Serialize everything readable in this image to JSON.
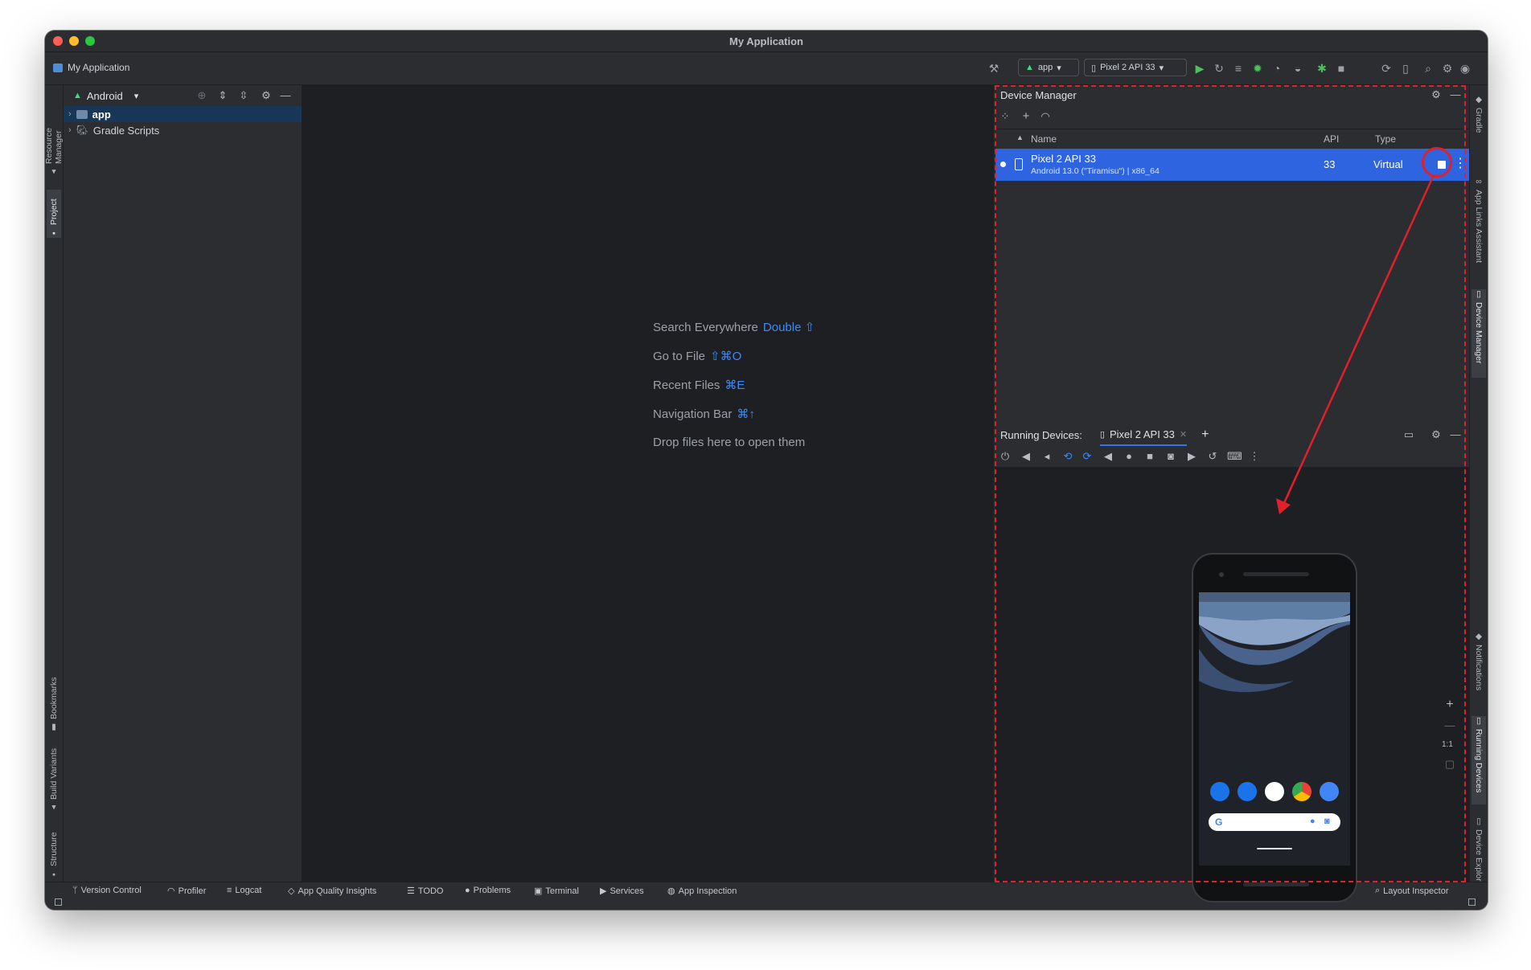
{
  "window": {
    "title": "My Application"
  },
  "toolbar": {
    "project": "My Application",
    "run_config": "app",
    "device": "Pixel 2 API 33"
  },
  "left_stripe": {
    "resource_manager": "Resource Manager",
    "project": "Project",
    "bookmarks": "Bookmarks",
    "build_variants": "Build Variants",
    "structure": "Structure"
  },
  "right_stripe": {
    "gradle": "Gradle",
    "app_links": "App Links Assistant",
    "device_manager": "Device Manager",
    "notifications": "Notifications",
    "running_devices": "Running Devices",
    "device_explorer": "Device Explorer"
  },
  "project_panel": {
    "view": "Android",
    "items": [
      {
        "label": "app"
      },
      {
        "label": "Gradle Scripts"
      }
    ]
  },
  "editor_hints": [
    {
      "label": "Search Everywhere",
      "key": "Double ⇧"
    },
    {
      "label": "Go to File",
      "key": "⇧⌘O"
    },
    {
      "label": "Recent Files",
      "key": "⌘E"
    },
    {
      "label": "Navigation Bar",
      "key": "⌘↑"
    },
    {
      "label": "Drop files here to open them",
      "key": ""
    }
  ],
  "device_manager": {
    "title": "Device Manager",
    "columns": {
      "name": "Name",
      "api": "API",
      "type": "Type"
    },
    "devices": [
      {
        "name": "Pixel 2 API 33",
        "subtitle": "Android 13.0 (\"Tiramisu\") | x86_64",
        "api": "33",
        "type": "Virtual"
      }
    ]
  },
  "running_devices": {
    "title": "Running Devices:",
    "tab": "Pixel 2 API 33",
    "zoom_reset": "1:1"
  },
  "statusbar": {
    "items": [
      "Version Control",
      "Profiler",
      "Logcat",
      "App Quality Insights",
      "TODO",
      "Problems",
      "Terminal",
      "Services",
      "App Inspection"
    ],
    "right": "Layout Inspector"
  },
  "colors": {
    "accent": "#2f64e0",
    "annotation": "#e0202a",
    "run_green": "#4fbf5a",
    "android_green": "#3ddc84"
  }
}
